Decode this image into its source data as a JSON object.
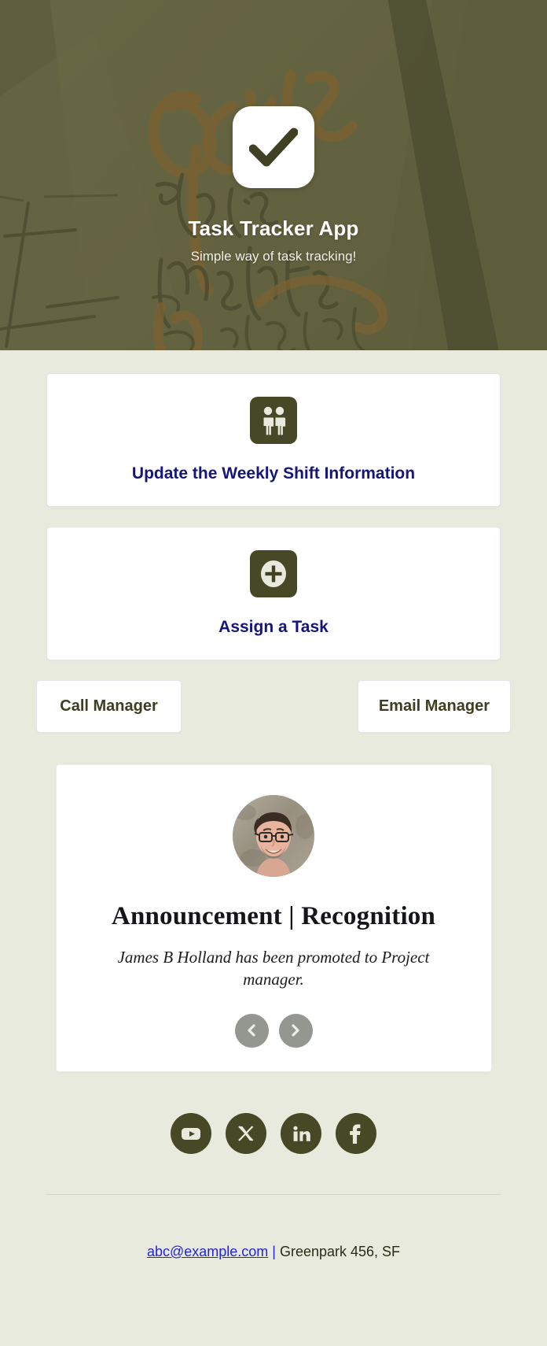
{
  "hero": {
    "logo_icon": "checkmark-icon",
    "title": "Task Tracker App",
    "subtitle": "Simple way of task tracking!",
    "overlay_color": "#565535",
    "background_description": "handwritten goals-this-month journal photo"
  },
  "cards": [
    {
      "icon": "two-people-icon",
      "label": "Update the Weekly Shift Information",
      "link_color": "#15157c"
    },
    {
      "icon": "plus-circle-icon",
      "label": "Assign a Task",
      "link_color": "#15157c"
    }
  ],
  "buttons": [
    {
      "label": "Call Manager"
    },
    {
      "label": "Email Manager"
    }
  ],
  "announcement": {
    "avatar_icon": "user-photo-avatar",
    "title": "Announcement | Recognition",
    "body": "James B Holland has been promoted to Project manager.",
    "prev_label": "chevron-left-icon",
    "next_label": "chevron-right-icon"
  },
  "social": [
    {
      "name": "youtube",
      "label": "YouTube"
    },
    {
      "name": "x-twitter",
      "label": "X"
    },
    {
      "name": "linkedin",
      "label": "LinkedIn"
    },
    {
      "name": "facebook",
      "label": "Facebook"
    }
  ],
  "footer": {
    "email": "abc@example.com",
    "separator": " | ",
    "address": "Greenpark 456, SF"
  },
  "colors": {
    "page_background": "#e9eade",
    "olive_dark": "#474826",
    "olive_hero": "#565535",
    "navy_link": "#15157c",
    "cream": "#e9eade",
    "carousel_gray": "#949690",
    "footer_link": "#2323e0"
  }
}
